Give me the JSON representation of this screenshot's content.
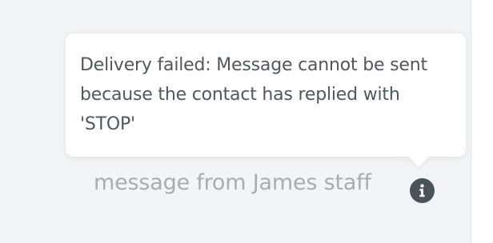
{
  "message": {
    "text": "message from James staff",
    "status_icon": "info-icon"
  },
  "tooltip": {
    "text": "Delivery failed: Message cannot be sent because the contact has replied with 'STOP'"
  },
  "colors": {
    "background": "#f3f4f6",
    "bubble": "#f2f4f5",
    "bubble_text": "#a7adb3",
    "icon": "#4b535a",
    "tooltip_text": "#4f5861"
  }
}
